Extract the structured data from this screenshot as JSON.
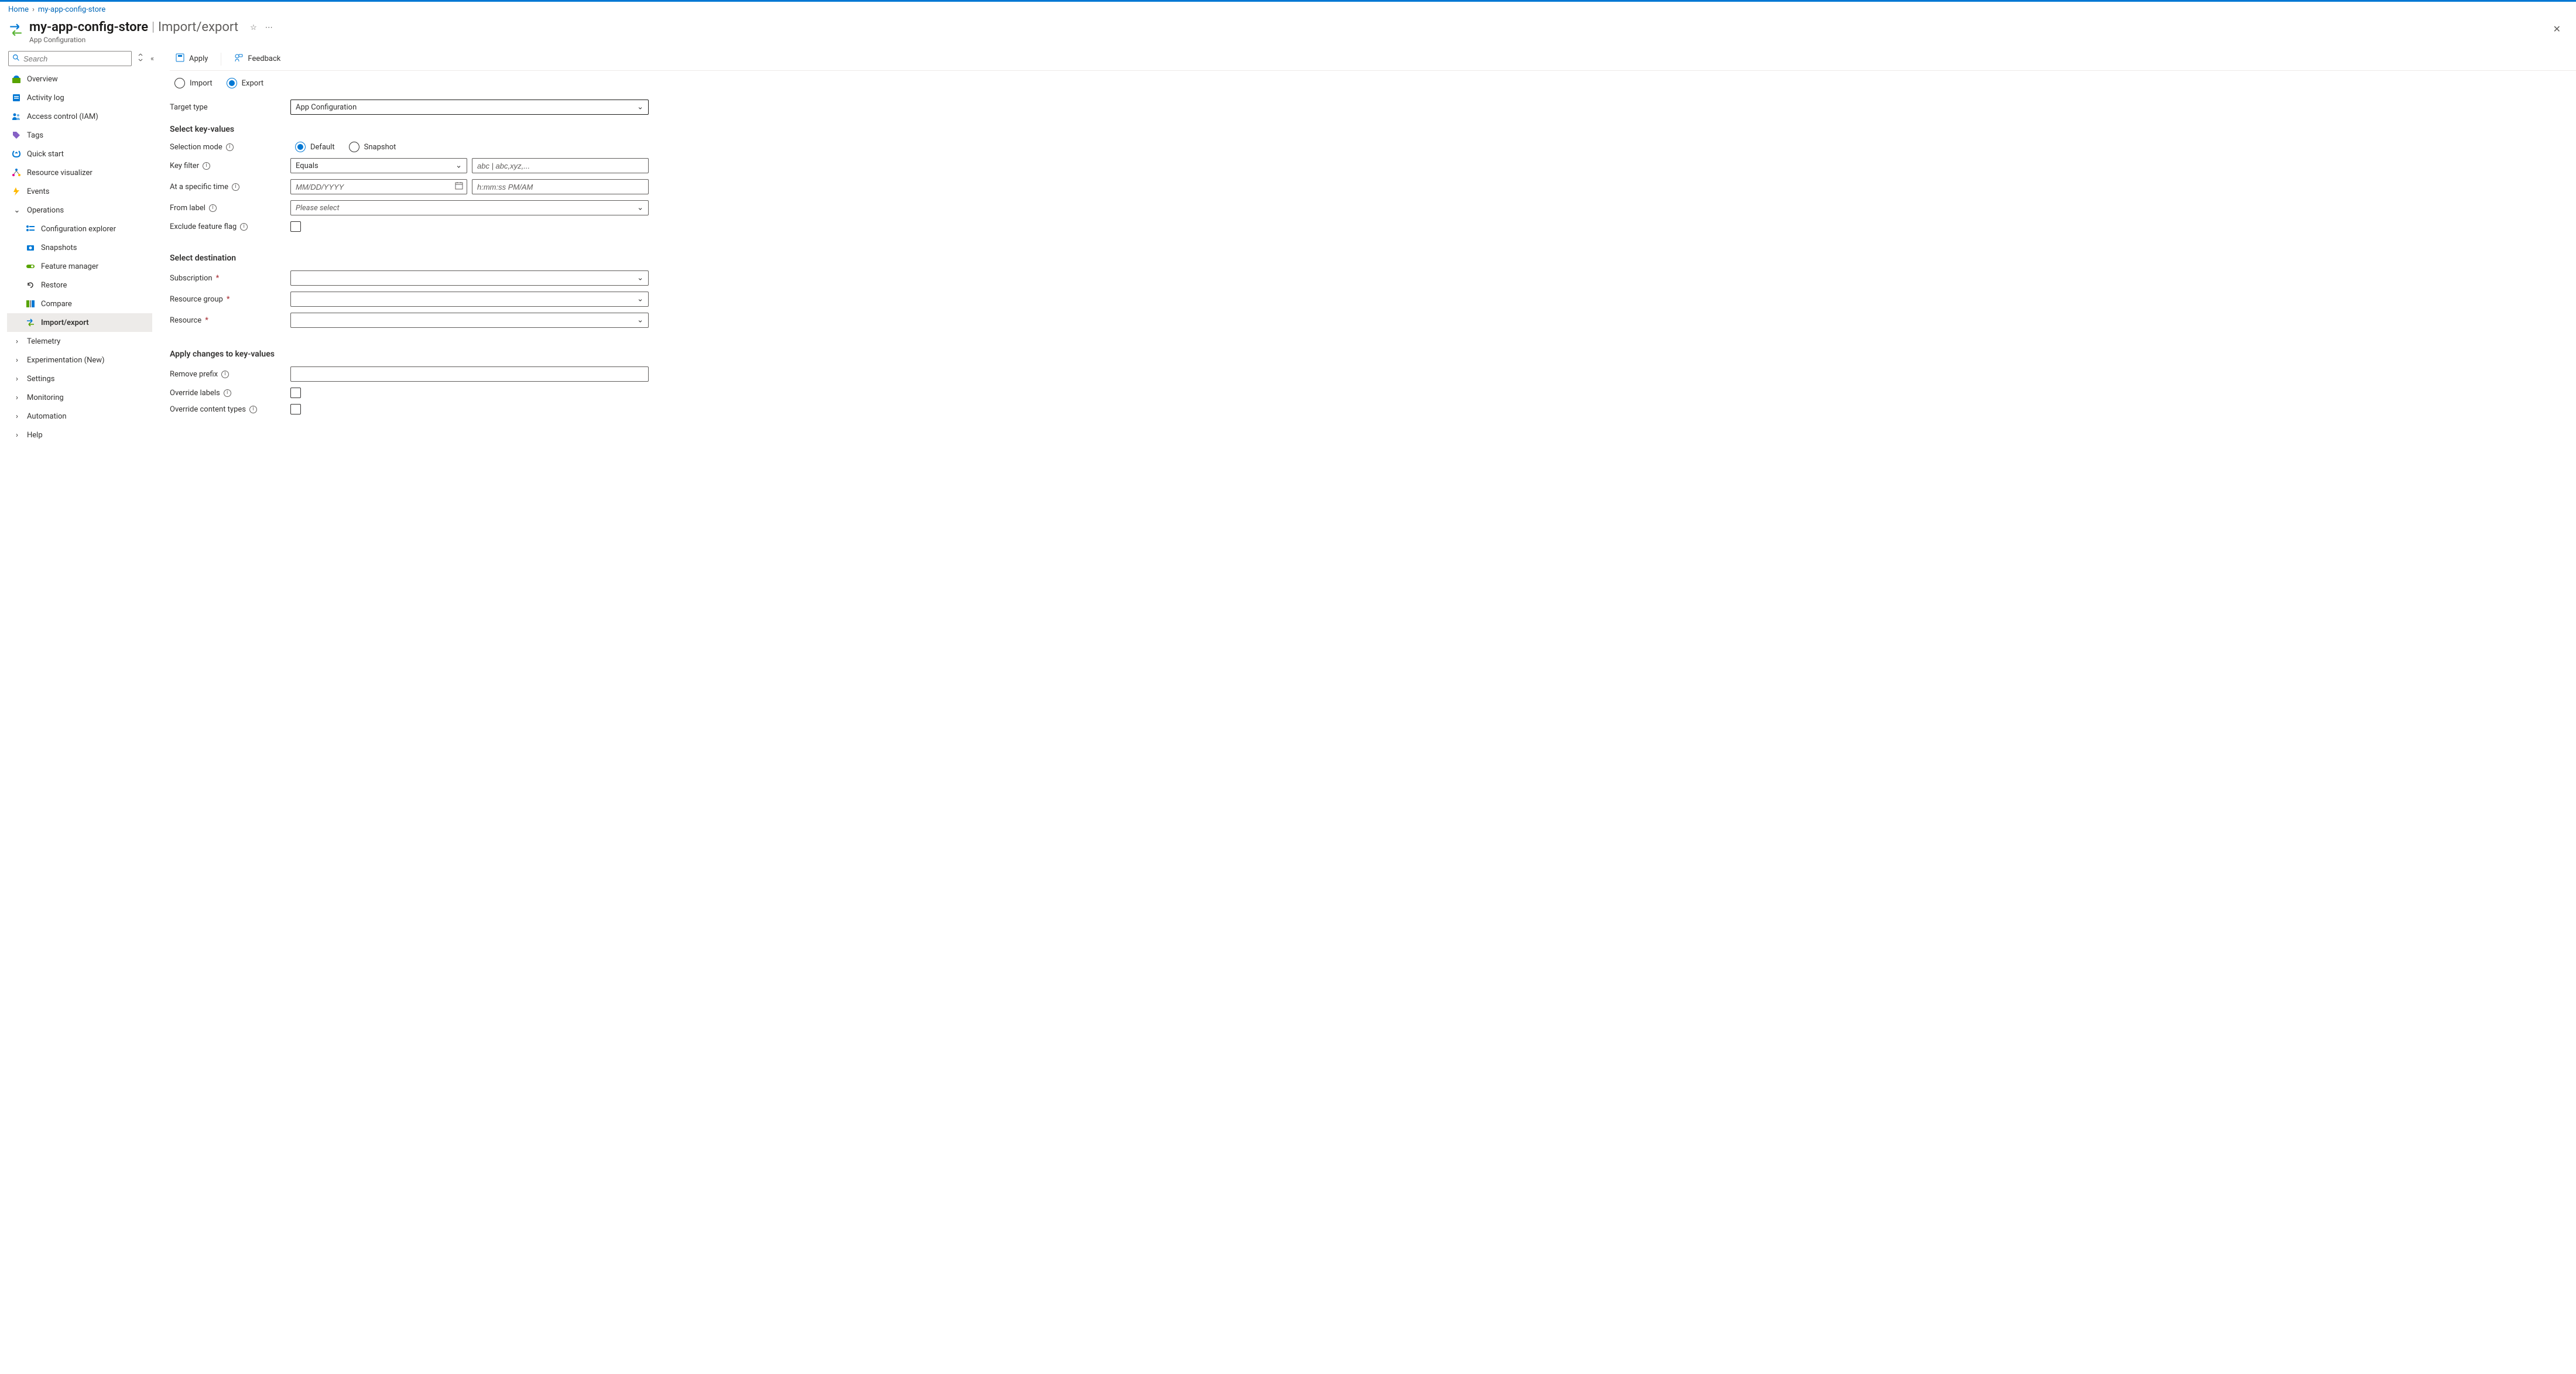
{
  "breadcrumb": {
    "home": "Home",
    "resource": "my-app-config-store"
  },
  "header": {
    "name": "my-app-config-store",
    "section": "Import/export",
    "subtitle": "App Configuration"
  },
  "sidebar": {
    "search_placeholder": "Search",
    "items": {
      "overview": "Overview",
      "activity_log": "Activity log",
      "iam": "Access control (IAM)",
      "tags": "Tags",
      "quick_start": "Quick start",
      "resource_visualizer": "Resource visualizer",
      "events": "Events",
      "operations": "Operations",
      "config_explorer": "Configuration explorer",
      "snapshots": "Snapshots",
      "feature_manager": "Feature manager",
      "restore": "Restore",
      "compare": "Compare",
      "import_export": "Import/export",
      "telemetry": "Telemetry",
      "experimentation": "Experimentation (New)",
      "settings": "Settings",
      "monitoring": "Monitoring",
      "automation": "Automation",
      "help": "Help"
    }
  },
  "toolbar": {
    "apply": "Apply",
    "feedback": "Feedback"
  },
  "mode": {
    "import": "Import",
    "export": "Export"
  },
  "form": {
    "target_type_label": "Target type",
    "target_type_value": "App Configuration",
    "select_kv_header": "Select key-values",
    "selection_mode_label": "Selection mode",
    "selection_default": "Default",
    "selection_snapshot": "Snapshot",
    "key_filter_label": "Key filter",
    "key_filter_value": "Equals",
    "key_filter_placeholder": "abc | abc,xyz,...",
    "at_time_label": "At a specific time",
    "date_placeholder": "MM/DD/YYYY",
    "time_placeholder": "h:mm:ss PM/AM",
    "from_label_label": "From label",
    "from_label_placeholder": "Please select",
    "exclude_ff_label": "Exclude feature flag",
    "select_dest_header": "Select destination",
    "subscription_label": "Subscription",
    "resource_group_label": "Resource group",
    "resource_label": "Resource",
    "apply_changes_header": "Apply changes to key-values",
    "remove_prefix_label": "Remove prefix",
    "override_labels_label": "Override labels",
    "override_ct_label": "Override content types"
  }
}
